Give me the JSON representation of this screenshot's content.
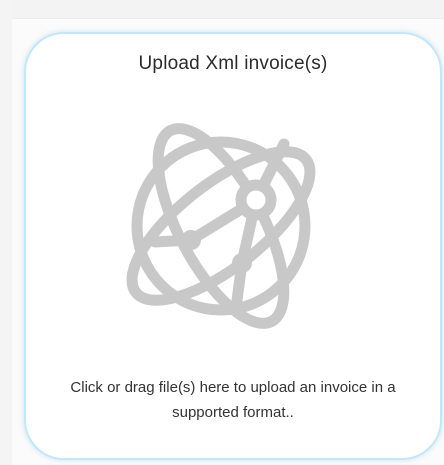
{
  "upload": {
    "title": "Upload Xml invoice(s)",
    "hint": "Click or drag file(s) here to upload an invoice in a supported format..",
    "icon": "atom-globe-icon"
  },
  "colors": {
    "border": "#c4e6f8",
    "icon": "#c8c8c8",
    "text": "#333333",
    "background": "#ffffff"
  }
}
